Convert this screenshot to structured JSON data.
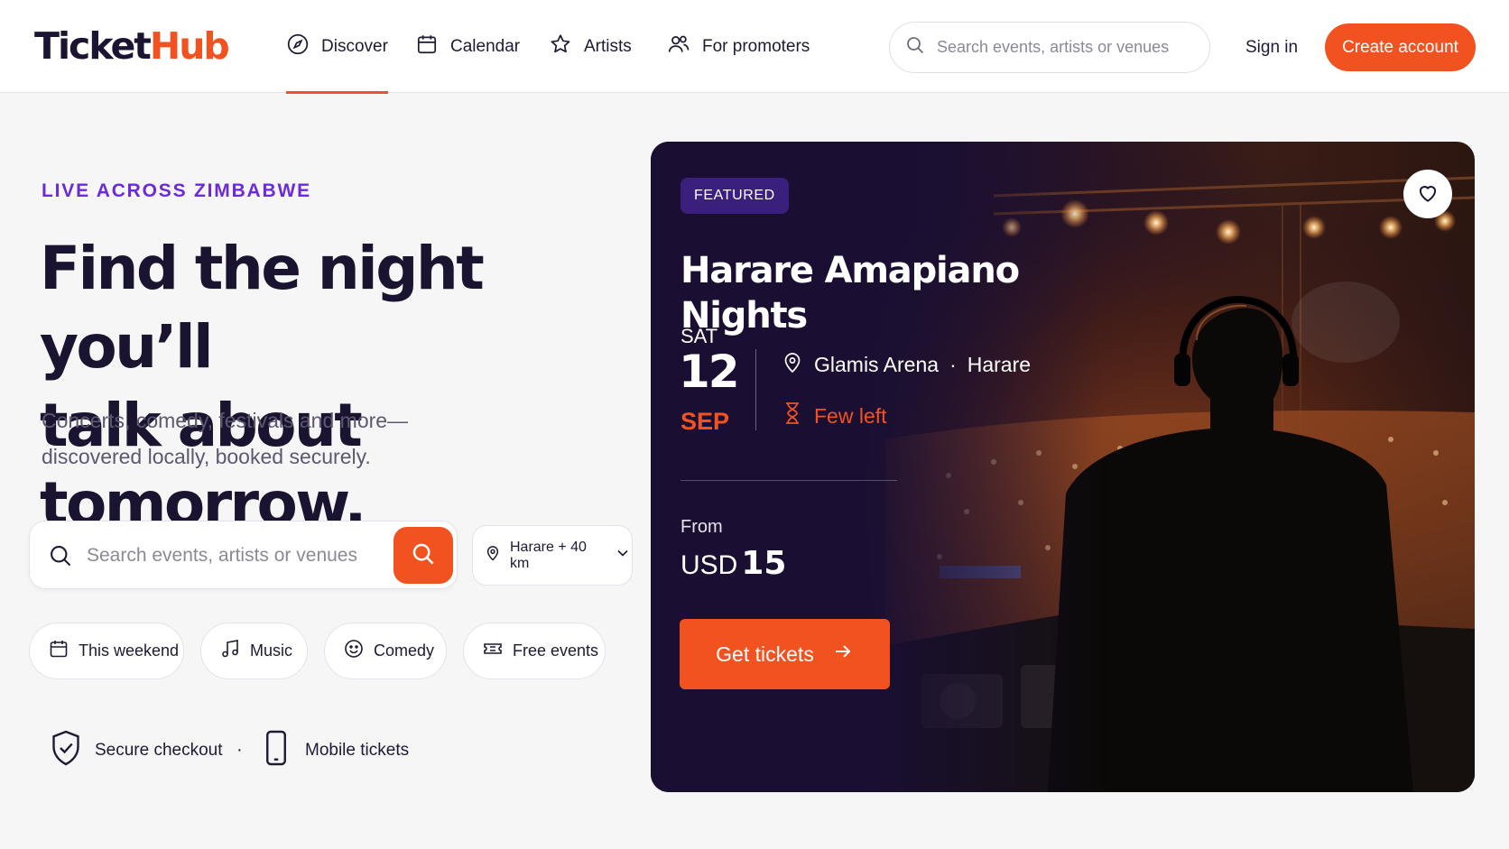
{
  "brand": {
    "logo_part1": "Ticket",
    "logo_part2": "Hub",
    "accent": "#f2521f",
    "purple": "#6b2bd9"
  },
  "nav": {
    "links": [
      {
        "label": "Discover",
        "icon": "compass-icon",
        "active": true
      },
      {
        "label": "Calendar",
        "icon": "calendar-icon"
      },
      {
        "label": "Artists",
        "icon": "star-icon"
      },
      {
        "label": "For promoters",
        "icon": "users-icon"
      }
    ],
    "search_placeholder": "Search events, artists or venues",
    "sign_in": "Sign in",
    "create_account": "Create account"
  },
  "hero": {
    "eyebrow": "LIVE ACROSS ZIMBABWE",
    "headline_line1": "Find the night you’ll",
    "headline_line2": "talk about tomorrow.",
    "subcopy_line1": "Concerts, comedy, festivals and more—",
    "subcopy_line2": "discovered locally, booked securely.",
    "search_placeholder": "Search events, artists or venues",
    "location": "Harare + 40 km",
    "chips": [
      {
        "label": "This weekend",
        "icon": "calendar-icon"
      },
      {
        "label": "Music",
        "icon": "music-note-icon"
      },
      {
        "label": "Comedy",
        "icon": "smiley-icon"
      },
      {
        "label": "Free events",
        "icon": "ticket-icon"
      }
    ],
    "trust": [
      {
        "label": "Secure checkout",
        "icon": "shield-check-icon"
      },
      {
        "label": "Mobile tickets",
        "icon": "smartphone-icon"
      }
    ],
    "trust_separator": "·"
  },
  "featured": {
    "badge": "FEATURED",
    "title": "Harare Amapiano Nights",
    "day": "SAT",
    "date": "12",
    "month": "SEP",
    "venue": "Glamis Arena",
    "venue_separator": "·",
    "city": "Harare",
    "availability": "Few left",
    "from_label": "From",
    "currency": "USD",
    "price": "15",
    "cta": "Get tickets"
  }
}
